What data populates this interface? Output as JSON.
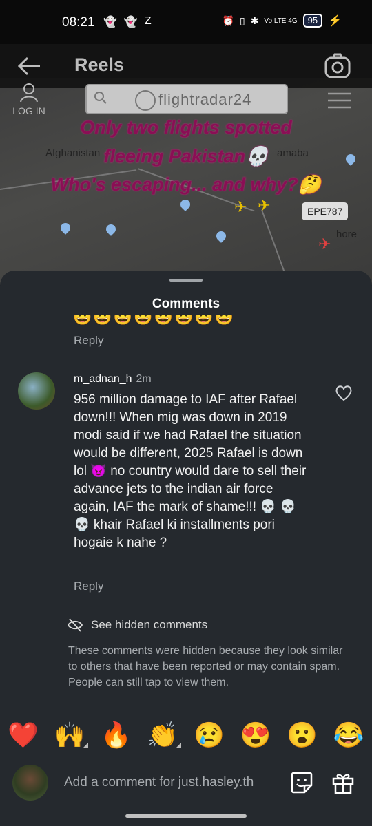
{
  "status": {
    "time": "08:21",
    "left_icons": [
      "👻",
      "👻",
      "Z"
    ],
    "right_text": "Vo LTE 4G",
    "battery": "95"
  },
  "reel": {
    "title": "Reels",
    "login_label": "LOG IN",
    "search_brand": "flightradar24",
    "overlay_lines": [
      "Only two flights spotted",
      "fleeing Pakistan💀",
      "Who's escaping... and why?🤔"
    ],
    "map_labels": [
      "Afghanistan",
      "amaba",
      "hore"
    ],
    "flight_tag": "EPE787"
  },
  "sheet": {
    "title": "Comments",
    "prev_reply": "Reply",
    "comment": {
      "username": "m_adnan_h",
      "time": "2m",
      "text": "956 million damage to IAF after Rafael down!!! When mig was down in 2019 modi said if we had Rafael the situation would be different, 2025 Rafael is down lol 😈 no country would dare to sell their advance jets to the indian air force again, IAF the mark of shame!!! 💀 💀💀 khair Rafael ki installments pori hogaie k nahe ?",
      "reply": "Reply"
    },
    "hidden": {
      "label": "See hidden comments",
      "description": "These comments were hidden because they look similar to others that have been reported or may contain spam. People can still tap to view them."
    },
    "reactions": [
      "❤️",
      "🙌",
      "🔥",
      "👏",
      "😢",
      "😍",
      "😮",
      "😂"
    ],
    "comment_placeholder": "Add a comment for just.hasley.th"
  }
}
